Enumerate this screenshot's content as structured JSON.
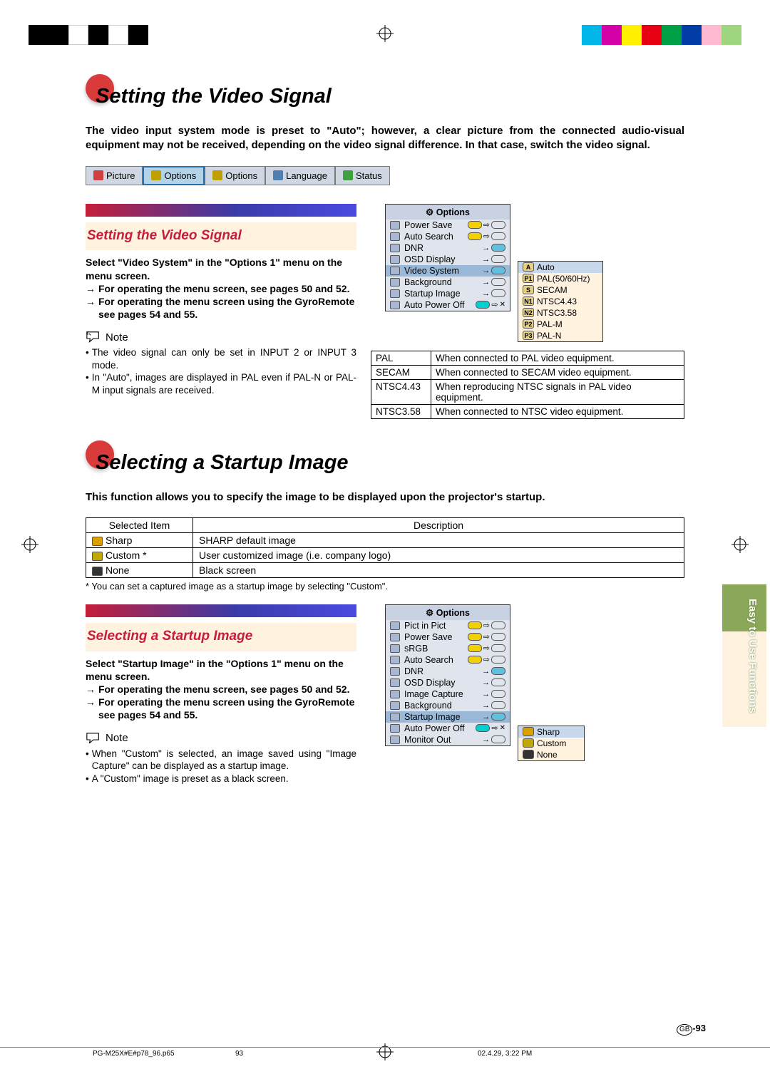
{
  "colors": {
    "red_dot": "#d93a3a",
    "sub_title": "#c41e3a",
    "beige": "#fff3e0"
  },
  "swatches_left": [
    "#000",
    "#000",
    "#fff",
    "#000",
    "#fff",
    "#000"
  ],
  "swatches_right": [
    "#00b5e8",
    "#d400a8",
    "#fff100",
    "#e60012",
    "#00a046",
    "#003da6",
    "#ffbad2",
    "#9ed680"
  ],
  "section1": {
    "title": "Setting the Video Signal",
    "intro": "The video input system mode is preset to \"Auto\"; however, a clear picture from the connected audio-visual equipment may not be received, depending on the video signal difference. In that case, switch the video signal.",
    "tabs": [
      "Picture",
      "Options",
      "Options",
      "Language",
      "Status"
    ],
    "sub_title": "Setting the Video Signal",
    "p1": "Select \"Video System\" in the \"Options 1\" menu on the menu screen.",
    "p2": "For operating the menu screen, see pages 50 and 52.",
    "p3": "For operating the menu screen using the GyroRemote see pages 54 and 55.",
    "note_label": "Note",
    "note1": "The video signal can only be set in INPUT 2 or INPUT 3 mode.",
    "note2": "In \"Auto\", images are displayed in PAL even if PAL-N or PAL-M input signals are received.",
    "osd": {
      "head": "Options",
      "rows": [
        {
          "t": "Power Save",
          "s": "pill-on"
        },
        {
          "t": "Auto Search",
          "s": "pill-on"
        },
        {
          "t": "DNR",
          "s": "arrow-num"
        },
        {
          "t": "OSD Display",
          "s": "arrow-ico"
        },
        {
          "t": "Video System",
          "s": "arrow-sel",
          "sel": true
        },
        {
          "t": "Background",
          "s": "arrow-ico"
        },
        {
          "t": "Startup Image",
          "s": "arrow-ico"
        },
        {
          "t": "Auto Power Off",
          "s": "pill-cyan"
        }
      ]
    },
    "sub_menu": {
      "items": [
        {
          "b": "A",
          "t": "Auto",
          "sel": true
        },
        {
          "b": "P1",
          "t": "PAL(50/60Hz)"
        },
        {
          "b": "S",
          "t": "SECAM"
        },
        {
          "b": "N1",
          "t": "NTSC4.43"
        },
        {
          "b": "N2",
          "t": "NTSC3.58"
        },
        {
          "b": "P2",
          "t": "PAL-M"
        },
        {
          "b": "P3",
          "t": "PAL-N"
        }
      ]
    },
    "signal_table": [
      {
        "k": "PAL",
        "v": "When connected to PAL video equipment."
      },
      {
        "k": "SECAM",
        "v": "When connected to SECAM video equipment."
      },
      {
        "k": "NTSC4.43",
        "v": "When reproducing NTSC signals in PAL video equipment."
      },
      {
        "k": "NTSC3.58",
        "v": "When connected to NTSC video equipment."
      }
    ]
  },
  "section2": {
    "title": "Selecting a Startup Image",
    "intro": "This function allows you to specify the image to be displayed upon the projector's startup.",
    "table_head": [
      "Selected Item",
      "Description"
    ],
    "table_rows": [
      {
        "k": "Sharp",
        "v": "SHARP default image"
      },
      {
        "k": "Custom *",
        "v": "User customized image (i.e. company logo)"
      },
      {
        "k": "None",
        "v": "Black screen"
      }
    ],
    "footnote": "* You can set a captured image as a startup image by selecting \"Custom\".",
    "sub_title": "Selecting a Startup Image",
    "p1": "Select \"Startup Image\" in the \"Options 1\" menu on the menu screen.",
    "p2": "For operating the menu screen, see pages 50 and 52.",
    "p3": "For operating the menu screen using the GyroRemote see pages 54 and 55.",
    "note_label": "Note",
    "note1": "When \"Custom\" is selected, an image saved using \"Image Capture\" can be displayed as a startup image.",
    "note2": "A \"Custom\" image is preset as a black screen.",
    "osd": {
      "head": "Options",
      "rows": [
        {
          "t": "Pict in Pict",
          "s": "pill-on"
        },
        {
          "t": "Power Save",
          "s": "pill-on"
        },
        {
          "t": "sRGB",
          "s": "pill-on"
        },
        {
          "t": "Auto Search",
          "s": "pill-on"
        },
        {
          "t": "DNR",
          "s": "arrow-num"
        },
        {
          "t": "OSD Display",
          "s": "arrow-ico"
        },
        {
          "t": "Image Capture",
          "s": "arrow"
        },
        {
          "t": "Background",
          "s": "arrow-ico"
        },
        {
          "t": "Startup Image",
          "s": "arrow-sel",
          "sel": true
        },
        {
          "t": "Auto Power Off",
          "s": "pill-cyan"
        },
        {
          "t": "Monitor Out",
          "s": "arrow-ico"
        }
      ]
    },
    "sub_menu": {
      "items": [
        {
          "b": "",
          "t": "Sharp",
          "sel": true,
          "c": "#d9a000"
        },
        {
          "b": "",
          "t": "Custom",
          "c": "#c0a800"
        },
        {
          "b": "",
          "t": "None",
          "c": "#333"
        }
      ]
    }
  },
  "side_tab": "Easy to Use Functions",
  "page_num": "-93",
  "page_gb": "GB",
  "meta": {
    "file": "PG-M25X#E#p78_96.p65",
    "pg": "93",
    "date": "02.4.29, 3:22 PM"
  }
}
